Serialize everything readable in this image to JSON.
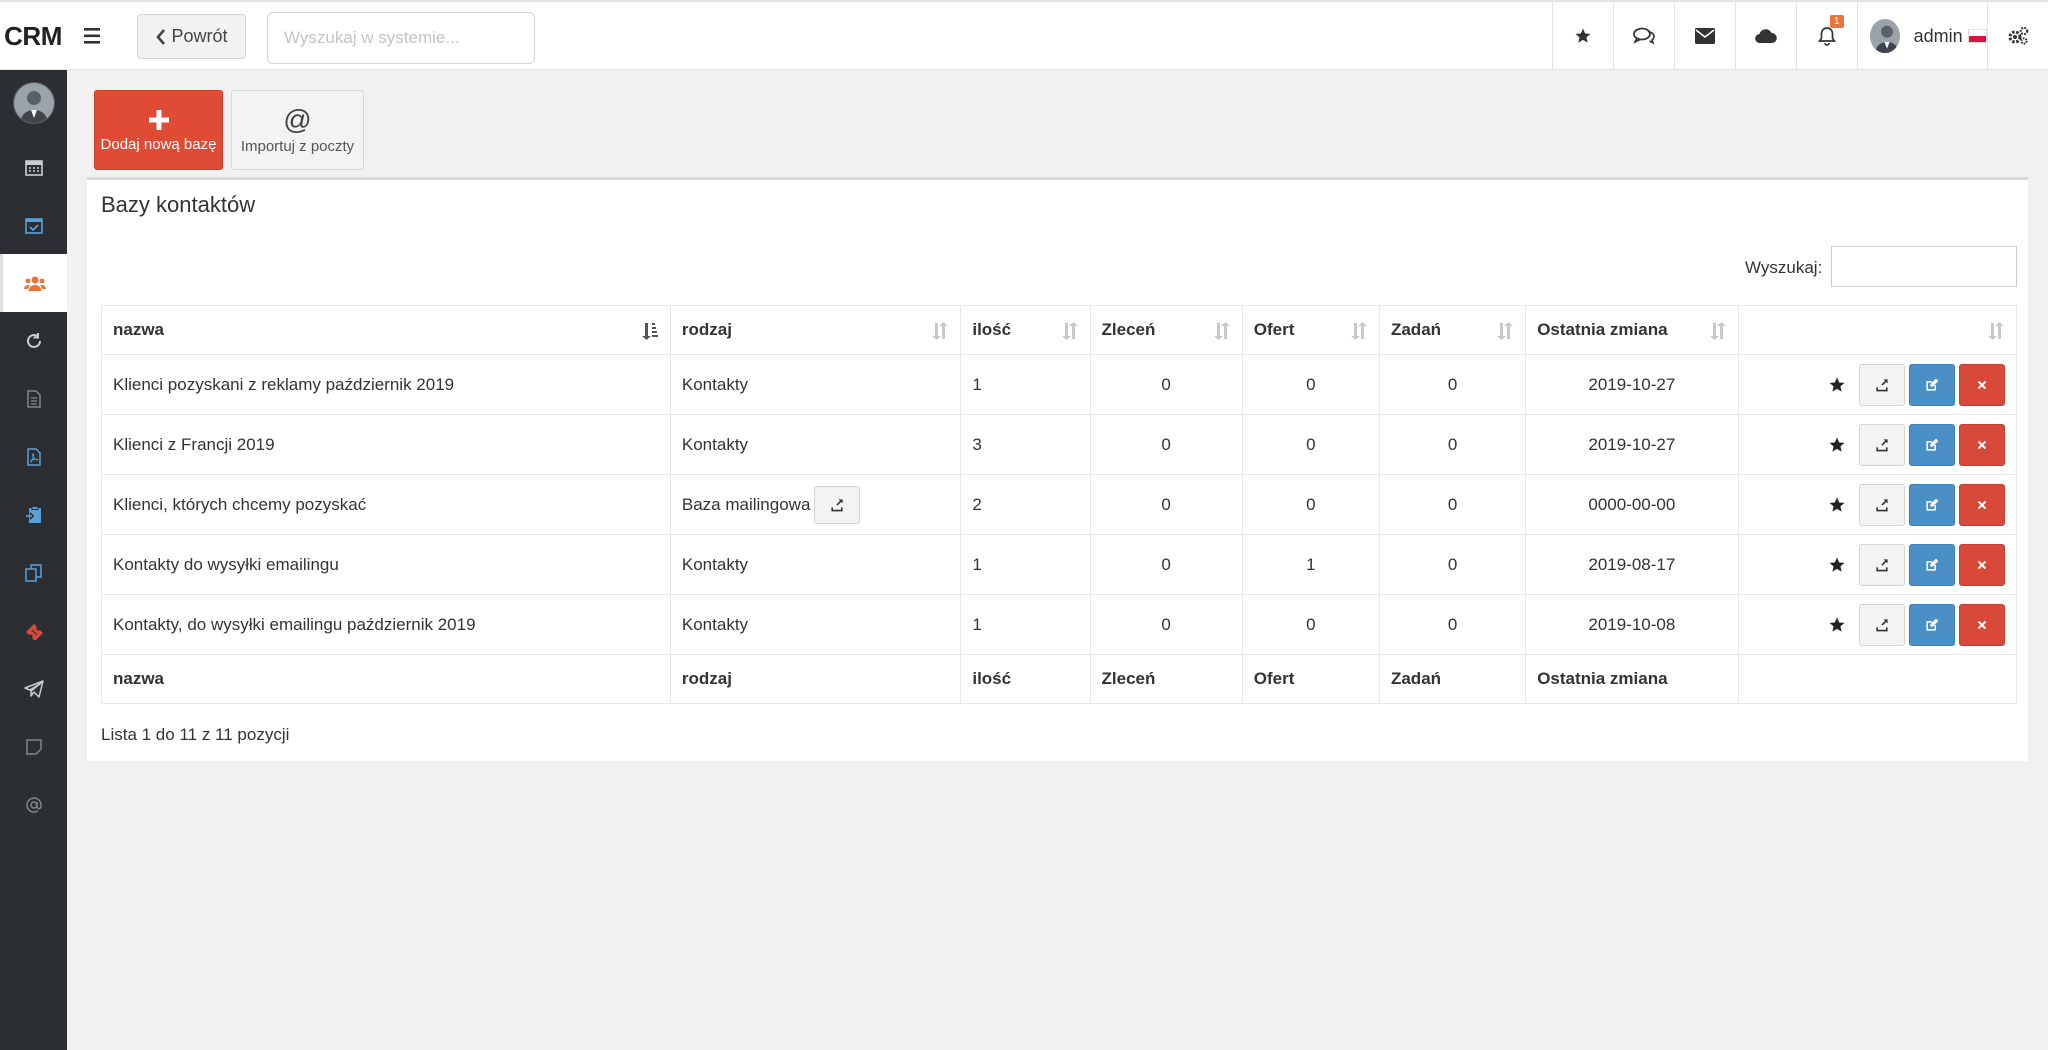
{
  "app": {
    "logo": "CRM"
  },
  "topbar": {
    "back_label": "Powrót",
    "search_placeholder": "Wyszukaj w systemie...",
    "notifications_count": "1",
    "user_name": "admin",
    "icons": [
      "star-icon",
      "comments-icon",
      "envelope-icon",
      "cloud-icon",
      "bell-icon",
      "gears-icon"
    ]
  },
  "sidebar": {
    "items": [
      {
        "icon": "calendar-icon"
      },
      {
        "icon": "calendar-check-icon"
      },
      {
        "icon": "users-icon",
        "active": true
      },
      {
        "icon": "refresh-icon"
      },
      {
        "icon": "document-icon"
      },
      {
        "icon": "pdf-icon"
      },
      {
        "icon": "clipboard-icon"
      },
      {
        "icon": "copy-icon"
      },
      {
        "icon": "ticket-icon"
      },
      {
        "icon": "paper-plane-icon"
      },
      {
        "icon": "note-icon"
      },
      {
        "icon": "at-icon"
      }
    ]
  },
  "toolbar": {
    "add_label": "Dodaj nową bazę",
    "import_symbol": "@",
    "import_label": "Importuj z poczty"
  },
  "panel": {
    "title": "Bazy kontaktów",
    "filter_label": "Wyszukaj:",
    "columns": [
      "nazwa",
      "rodzaj",
      "ilość",
      "Zleceń",
      "Ofert",
      "Zadań",
      "Ostatnia zmiana"
    ],
    "rows": [
      {
        "name": "Klienci pozyskani z reklamy październik 2019",
        "type": "Kontakty",
        "count": "1",
        "orders": "0",
        "offers": "0",
        "tasks": "0",
        "changed": "2019-10-27"
      },
      {
        "name": "Klienci z Francji 2019",
        "type": "Kontakty",
        "count": "3",
        "orders": "0",
        "offers": "0",
        "tasks": "0",
        "changed": "2019-10-27"
      },
      {
        "name": "Klienci, których chcemy pozyskać",
        "type": "Baza mailingowa",
        "count": "2",
        "orders": "0",
        "offers": "0",
        "tasks": "0",
        "changed": "0000-00-00"
      },
      {
        "name": "Kontakty do wysyłki emailingu",
        "type": "Kontakty",
        "count": "1",
        "orders": "0",
        "offers": "1",
        "tasks": "0",
        "changed": "2019-08-17"
      },
      {
        "name": "Kontakty, do wysyłki emailingu październik 2019",
        "type": "Kontakty",
        "count": "1",
        "orders": "0",
        "offers": "0",
        "tasks": "0",
        "changed": "2019-10-08"
      }
    ],
    "footer_info": "Lista 1 do 11 z 11 pozycji"
  },
  "colors": {
    "sidebar": "#2b2f33",
    "add_button": "#e04b35",
    "edit_button": "#4a90c6",
    "delete_button": "#d9493a",
    "active_icon": "#e8743b"
  }
}
